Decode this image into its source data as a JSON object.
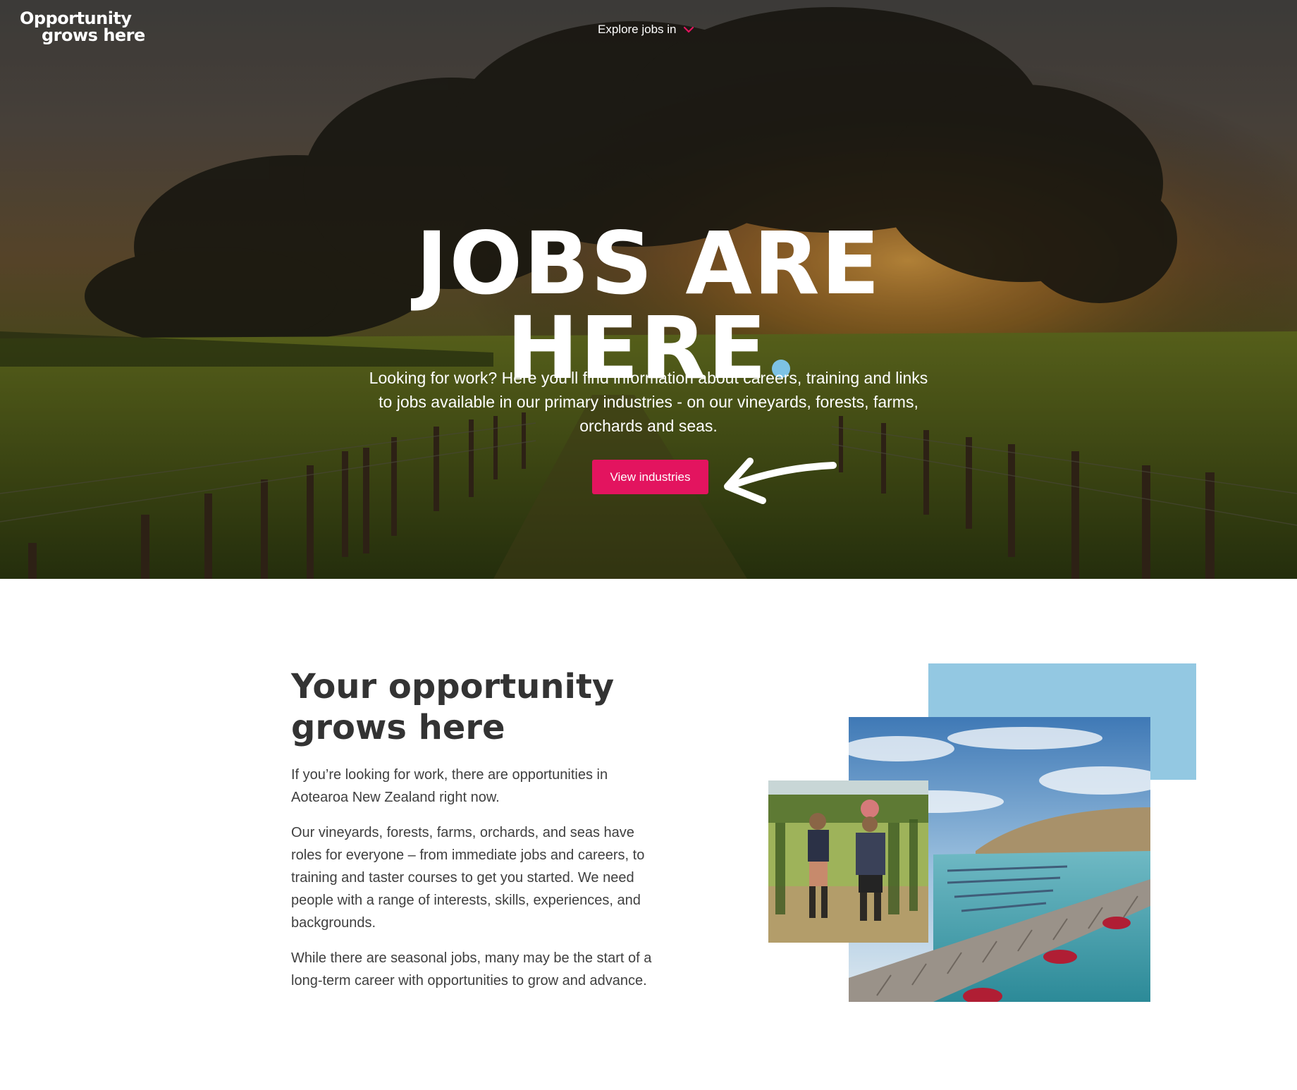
{
  "header": {
    "logo_line1": "Opportunity",
    "logo_line2": "grows here",
    "explore_label": "Explore jobs in",
    "explore_icon": "chevron-down-icon"
  },
  "hero": {
    "headline_line1": "JOBS ARE",
    "headline_line2": "HERE",
    "intro": "Looking for work? Here you’ll find information about careers, training and links to jobs available in our primary industries - on our vineyards, forests, farms, orchards and seas.",
    "cta_label": "View industries"
  },
  "section": {
    "title": "Your opportunity grows here",
    "paragraphs": [
      "If you’re looking for work, there are opportunities in Aotearoa New Zealand right now.",
      "Our vineyards, forests, farms, orchards, and seas have roles for everyone – from immediate jobs and careers, to training and taster courses to get you started. We need people with a range of interests, skills, experiences, and backgrounds.",
      "While there are seasonal jobs, many may be the start of a long-term career with opportunities to grow and advance."
    ]
  },
  "colors": {
    "accent": "#e3145f",
    "dot": "#7dc2e4",
    "collage_block": "#93c8e2",
    "heading": "#333333",
    "body_text": "#3f3f3f"
  }
}
